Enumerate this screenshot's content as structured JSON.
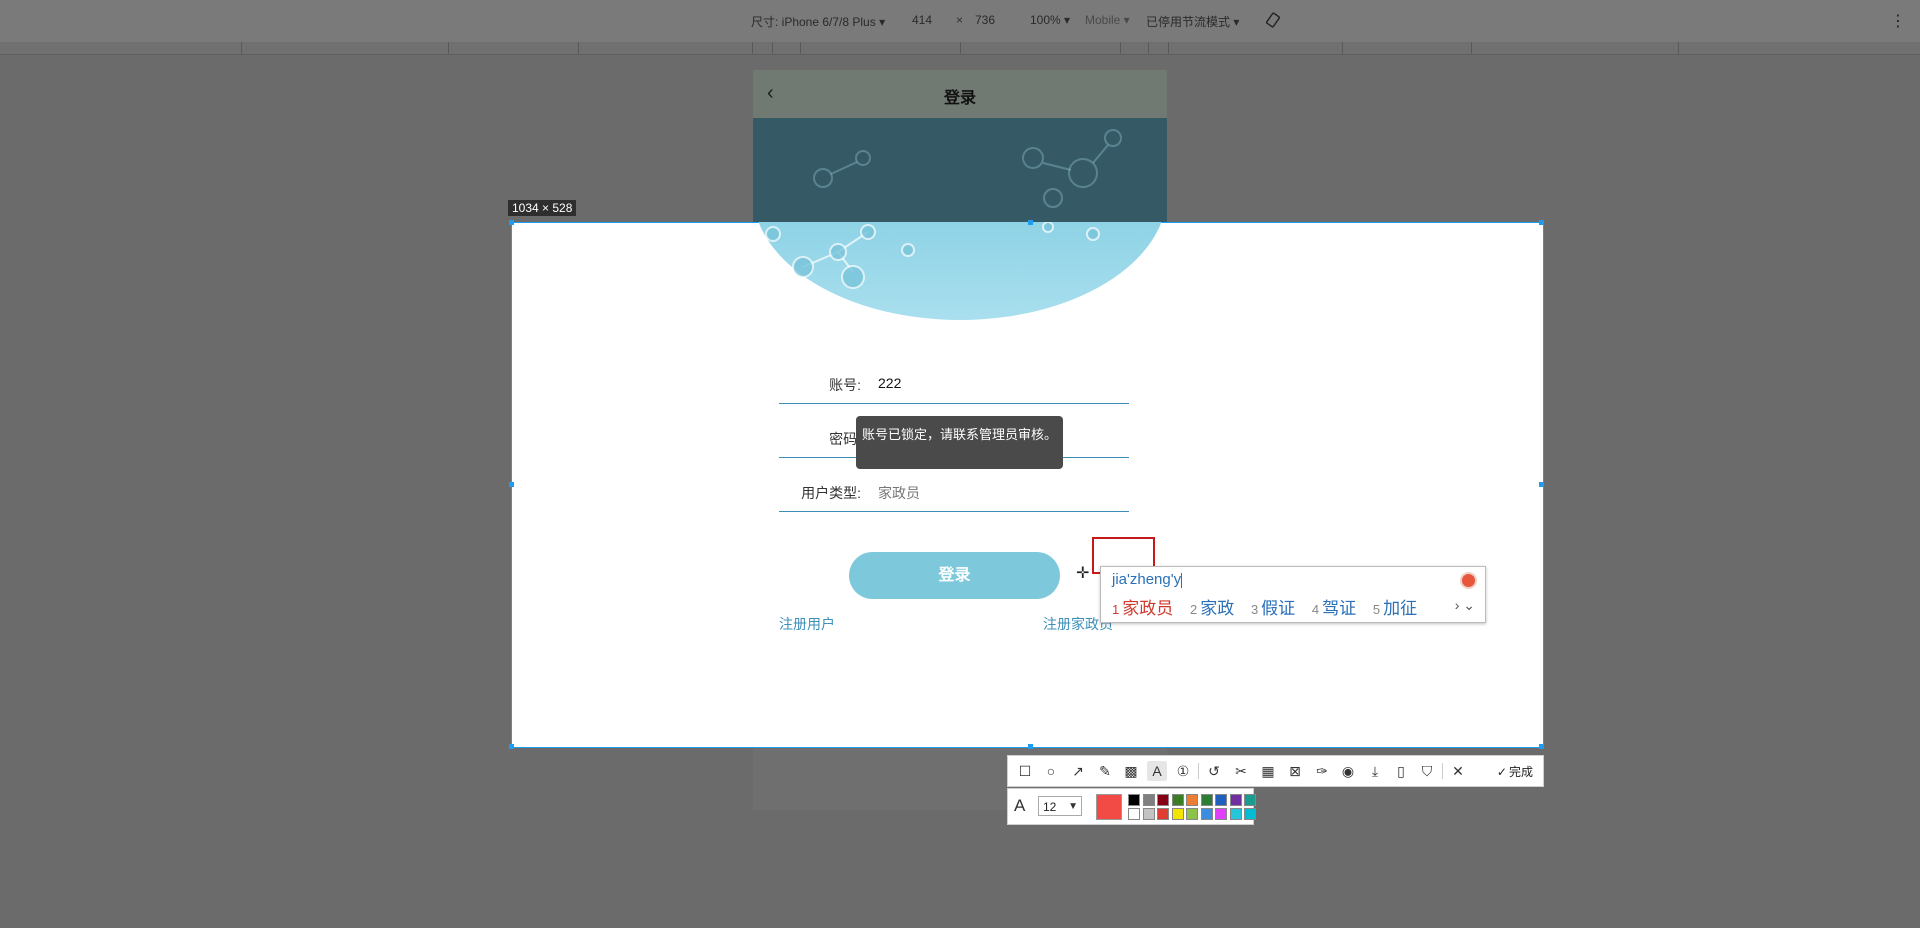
{
  "devtools": {
    "device_label": "尺寸: iPhone 6/7/8 Plus ▾",
    "width": "414",
    "x_sep": "×",
    "height": "736",
    "zoom": "100% ▾",
    "mobile": "Mobile ▾",
    "throttle": "已停用节流模式 ▾"
  },
  "capture": {
    "dimensions": "1034 × 528"
  },
  "page": {
    "title": "登录",
    "back_icon": "‹",
    "account_label": "账号:",
    "account_value": "222",
    "password_label": "密码:",
    "user_type_label": "用户类型:",
    "user_type_value": "家政员",
    "toast": "账号已锁定，请联系管理员审核。",
    "login_button": "登录",
    "register_user": "注册用户",
    "register_housekeeper": "注册家政员"
  },
  "ime": {
    "pinyin": "jia'zheng'y",
    "candidates": [
      {
        "num": "1",
        "text": "家政员"
      },
      {
        "num": "2",
        "text": "家政"
      },
      {
        "num": "3",
        "text": "假证"
      },
      {
        "num": "4",
        "text": "驾证"
      },
      {
        "num": "5",
        "text": "加征"
      }
    ],
    "nav": "› ⌄"
  },
  "toolbar": {
    "tools": [
      "rectangle-icon",
      "ellipse-icon",
      "arrow-icon",
      "pen-icon",
      "mosaic-icon",
      "text-icon",
      "number-icon",
      "undo-icon",
      "scissors-icon",
      "ocr-icon",
      "translate-icon",
      "pin-icon",
      "record-icon",
      "download-icon",
      "save-icon",
      "bookmark-icon",
      "close-icon"
    ],
    "done_label": "完成",
    "font_size": "12",
    "current_color": "#f24b46",
    "colors_row1": [
      "#000000",
      "#7f7f7f",
      "#880015",
      "#3a7d24",
      "#ed7d31",
      "#2e7d32",
      "#1f5fbf",
      "#7030a0",
      "#1a9c8f"
    ],
    "colors_row2": [
      "#ffffff",
      "#c3c3c3",
      "#e03c31",
      "#f2e500",
      "#8bc34a",
      "#3c8de0",
      "#e040fb",
      "#26c6da",
      "#00bcd4"
    ]
  }
}
